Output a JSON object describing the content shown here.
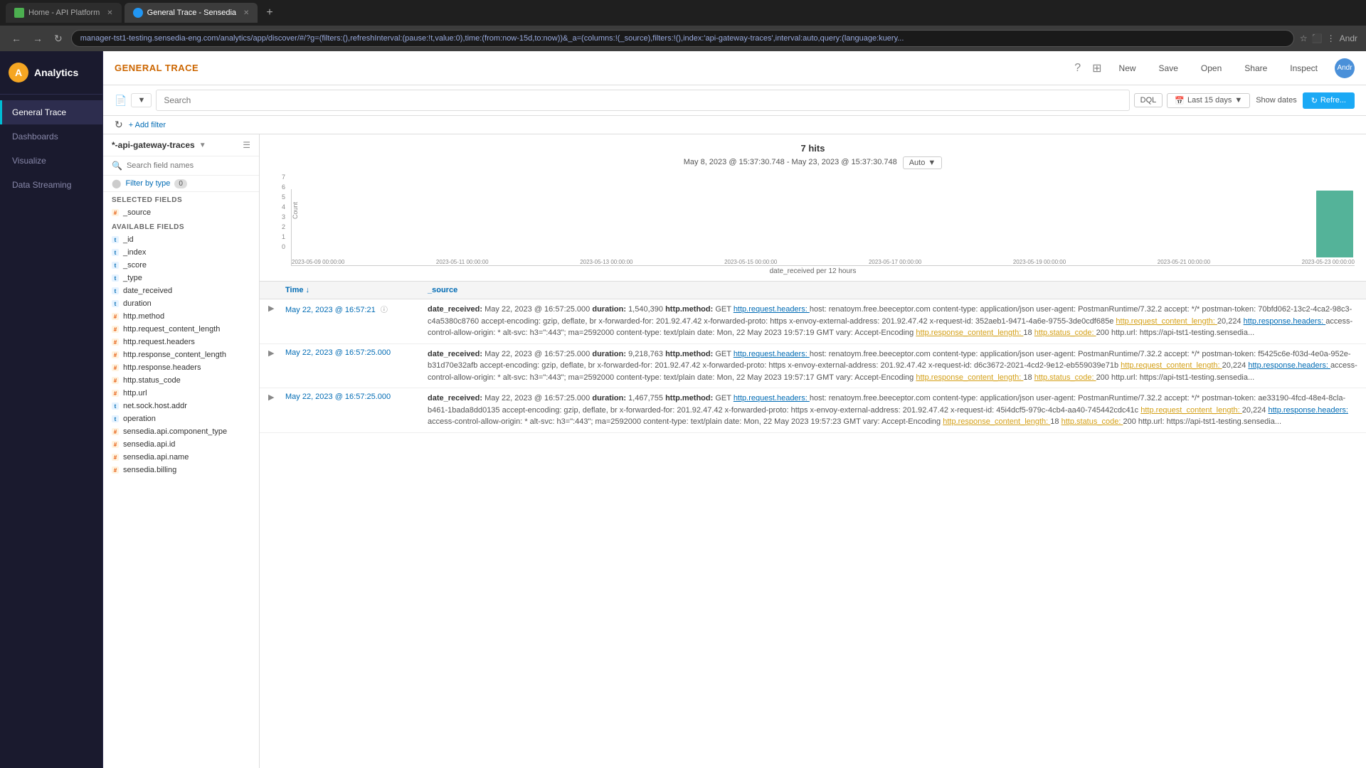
{
  "browser": {
    "tabs": [
      {
        "label": "Home - API Platform",
        "active": false,
        "favicon_type": "green"
      },
      {
        "label": "General Trace - Sensedia",
        "active": true,
        "favicon_type": "blue"
      }
    ],
    "url": "manager-tst1-testing.sensedia-eng.com/analytics/app/discover/#/?g=(filters:(),refreshInterval:(pause:!t,value:0),time:(from:now-15d,to:now))&_a=(columns:!(_source),filters:!(),index:'api-gateway-traces',interval:auto,query:(language:kuery...",
    "nav_right": "Andr"
  },
  "sidebar": {
    "logo_text": "Analytics",
    "logo_char": "A",
    "items": [
      {
        "label": "General Trace",
        "active": true
      },
      {
        "label": "Dashboards",
        "active": false
      },
      {
        "label": "Visualize",
        "active": false
      },
      {
        "label": "Data Streaming",
        "active": false
      }
    ]
  },
  "page": {
    "title": "GENERAL TRACE",
    "top_bar_buttons": [
      "New",
      "Save",
      "Open",
      "Share",
      "Inspect"
    ],
    "toolbar": {
      "search_placeholder": "Search",
      "dql_label": "DQL",
      "date_range": "Last 15 days",
      "show_dates": "Show dates",
      "refresh": "Refre..."
    },
    "filter_bar": {
      "add_filter": "+ Add filter"
    },
    "left_panel": {
      "index_name": "*-api-gateway-traces",
      "search_placeholder": "Search field names",
      "filter_by_type": "Filter by type",
      "filter_count": "0",
      "selected_fields_label": "Selected fields",
      "selected_fields": [
        {
          "name": "_source",
          "type": "hash"
        }
      ],
      "available_fields_label": "Available fields",
      "available_fields": [
        {
          "name": "_id",
          "type": "t"
        },
        {
          "name": "_index",
          "type": "t"
        },
        {
          "name": "_score",
          "type": "t"
        },
        {
          "name": "_type",
          "type": "t"
        },
        {
          "name": "date_received",
          "type": "t"
        },
        {
          "name": "duration",
          "type": "t"
        },
        {
          "name": "http.method",
          "type": "hash"
        },
        {
          "name": "http.request_content_length",
          "type": "hash"
        },
        {
          "name": "http.request.headers",
          "type": "hash"
        },
        {
          "name": "http.response_content_length",
          "type": "hash"
        },
        {
          "name": "http.response.headers",
          "type": "hash"
        },
        {
          "name": "http.status_code",
          "type": "hash"
        },
        {
          "name": "http.url",
          "type": "hash"
        },
        {
          "name": "net.sock.host.addr",
          "type": "t"
        },
        {
          "name": "operation",
          "type": "t"
        },
        {
          "name": "sensedia.api.component_type",
          "type": "hash"
        },
        {
          "name": "sensedia.api.id",
          "type": "hash"
        },
        {
          "name": "sensedia.api.name",
          "type": "hash"
        },
        {
          "name": "sensedia.billing",
          "type": "hash"
        }
      ]
    },
    "chart": {
      "hits": "7 hits",
      "date_range": "May 8, 2023 @ 15:37:30.748 - May 23, 2023 @ 15:37:30.748",
      "auto_label": "Auto",
      "y_labels": [
        "7",
        "6",
        "5",
        "4",
        "3",
        "2",
        "1",
        "0"
      ],
      "x_labels": [
        "2023-05-09 00:00:00",
        "2023-05-11 00:00:00",
        "2023-05-13 00:00:00",
        "2023-05-15 00:00:00",
        "2023-05-17 00:00:00",
        "2023-05-19 00:00:00",
        "2023-05-21 00:00:00",
        "2023-05-23 00:00:00"
      ],
      "x_axis_label": "date_received per 12 hours",
      "bars": [
        0,
        0,
        0,
        0,
        0,
        0,
        0,
        0,
        0,
        0,
        0,
        0,
        0,
        0,
        0,
        0,
        0,
        0,
        0,
        0,
        0,
        0,
        0,
        0,
        0,
        0,
        0,
        7
      ]
    },
    "results": {
      "col_time": "Time ↓",
      "col_source": "_source",
      "rows": [
        {
          "time": "May 22, 2023 @ 16:57:21",
          "source": "date_received: May 22, 2023 @ 16:57:25.000  duration: 1,540,390  http.method: GET  http.request.headers: host: renatoym.free.beeceptor.com content-type: application/json user-agent: PostmanRuntime/7.32.2 accept: */* postman-token: 70bfd062-13c2-4ca2-98c3-c4a5380c8760 accept-encoding: gzip, deflate, br x-forwarded-for: 201.92.47.42 x-forwarded-proto: https x-envoy-external-address: 201.92.47.42 x-request-id: 352aeb1-9471-4a6e-9755-3de0cdf685e  http.request_content_length: 20,224  http.response.headers: access-control-allow-origin: * alt-svc: h3=\":443\"; ma=2592000 content-type: text/plain date: Mon, 22 May 2023 19:57:19 GMT vary: Accept-Encoding  http.response_content_length: 18  http.status_code: 200  http.url: https://api-tst1-testing.sensedia..."
        },
        {
          "time": "May 22, 2023 @ 16:57:25.000",
          "source": "date_received: May 22, 2023 @ 16:57:25.000  duration: 9,218,763  http.method: GET  http.request.headers: host: renatoym.free.beeceptor.com content-type: application/json user-agent: PostmanRuntime/7.32.2 accept: */* postman-token: f5425c6e-f03d-4e0a-952e-b31d70e32afb accept-encoding: gzip, deflate, br x-forwarded-for: 201.92.47.42 x-forwarded-proto: https x-envoy-external-address: 201.92.47.42 x-request-id: d6c3672-2021-4cd2-9e12-eb559039e71b  http.request_content_length: 20,224  http.response.headers: access-control-allow-origin: * alt-svc: h3=\":443\"; ma=2592000 content-type: text/plain date: Mon, 22 May 2023 19:57:17 GMT vary: Accept-Encoding  http.response_content_length: 18  http.status_code: 200  http.url: https://api-tst1-testing.sensedia..."
        },
        {
          "time": "May 22, 2023 @ 16:57:25.000",
          "source": "date_received: May 22, 2023 @ 16:57:25.000  duration: 1,467,755  http.method: GET  http.request.headers: host: renatoym.free.beeceptor.com content-type: application/json user-agent: PostmanRuntime/7.32.2 accept: */* postman-token: ae33190-4fcd-48e4-8cla-b461-1bada8dd0135 accept-encoding: gzip, deflate, br x-forwarded-for: 201.92.47.42 x-forwarded-proto: https x-envoy-external-address: 201.92.47.42 x-request-id: 45i4dcf5-979c-4cb4-aa40-745442cdc41c  http.request_content_length: 20,224  http.response.headers: access-control-allow-origin: * alt-svc: h3=\":443\"; ma=2592000 content-type: text/plain date: Mon, 22 May 2023 19:57:23 GMT vary: Accept-Encoding  http.response_content_length: 18  http.status_code: 200  http.url: https://api-tst1-testing.sensedia..."
        }
      ]
    }
  }
}
